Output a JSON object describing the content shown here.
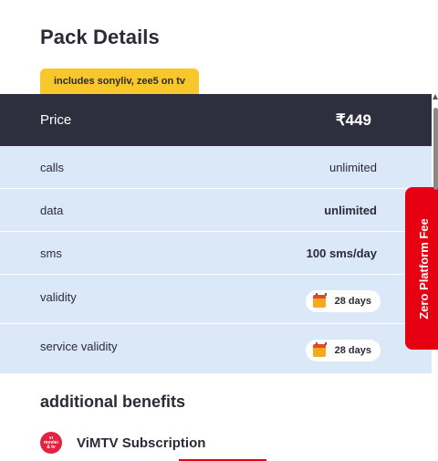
{
  "page_title": "Pack Details",
  "tag": "includes sonyliv, zee5 on tv",
  "price": {
    "label": "Price",
    "value": "₹449"
  },
  "rows": [
    {
      "key": "calls",
      "value": "unlimited"
    },
    {
      "key": "data",
      "value": "unlimited"
    },
    {
      "key": "sms",
      "value": "100 sms/day"
    },
    {
      "key": "validity",
      "value": "28 days"
    },
    {
      "key": "service validity",
      "value": "28 days"
    }
  ],
  "side_tab": "Zero Platform Fee",
  "additional": {
    "title": "additional benefits",
    "items": [
      {
        "logo_text": "Vi movies & tv",
        "name": "ViMTV Subscription"
      }
    ]
  },
  "colors": {
    "brand_red": "#e60012",
    "dark": "#2f2e3e",
    "light_blue": "#dbe8f8",
    "tag_yellow": "#f7c72b"
  },
  "icons": [
    "calendar-icon",
    "vimtv-logo-icon"
  ]
}
